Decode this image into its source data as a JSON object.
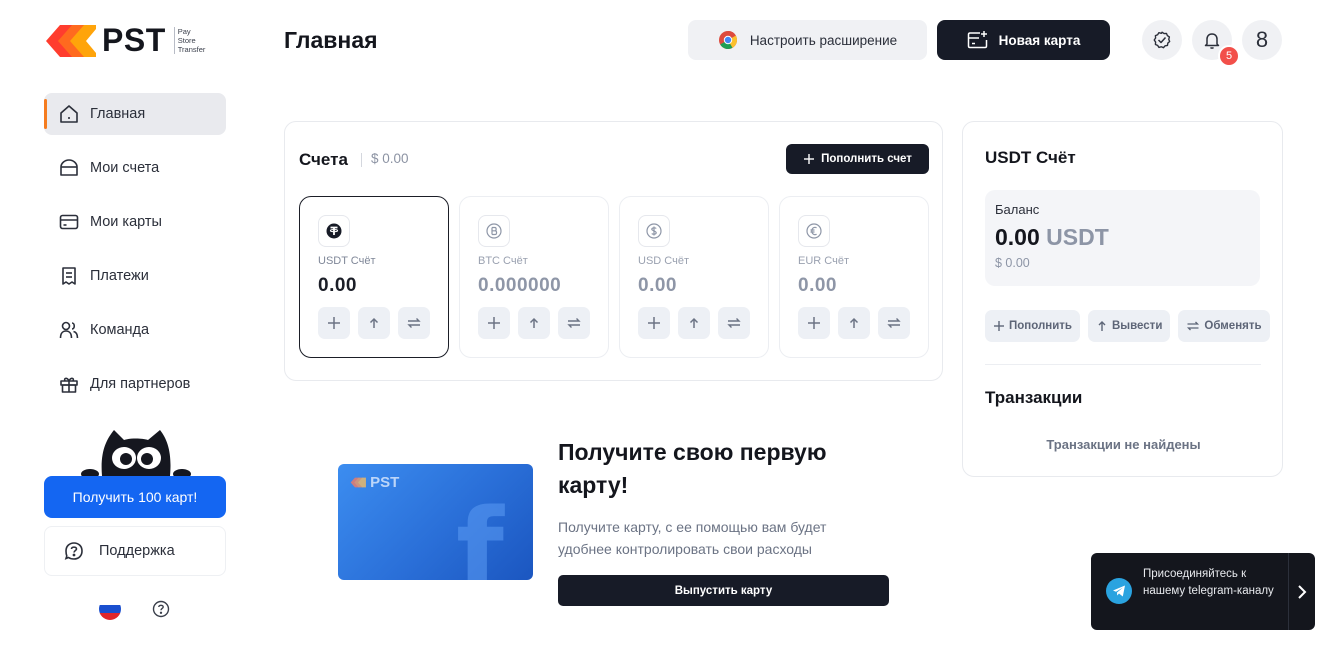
{
  "brand": {
    "name": "PST",
    "sub_line1": "Pay",
    "sub_line2": "Store",
    "sub_line3": "Transfer"
  },
  "sidebar": {
    "items": [
      {
        "label": "Главная",
        "icon": "home-icon",
        "active": true
      },
      {
        "label": "Мои счета",
        "icon": "wallet-icon",
        "active": false
      },
      {
        "label": "Мои карты",
        "icon": "card-icon",
        "active": false
      },
      {
        "label": "Платежи",
        "icon": "receipt-icon",
        "active": false
      },
      {
        "label": "Команда",
        "icon": "team-icon",
        "active": false
      },
      {
        "label": "Для партнеров",
        "icon": "gift-icon",
        "active": false
      }
    ],
    "promo_button": "Получить 100 карт!",
    "support_label": "Поддержка"
  },
  "header": {
    "title": "Главная",
    "extension_button": "Настроить расширение",
    "new_card_button": "Новая карта",
    "notification_count": "5",
    "avatar_initial": "8"
  },
  "accounts": {
    "title": "Счета",
    "total": "$ 0.00",
    "topup_button": "Пополнить счет",
    "cards": [
      {
        "name": "USDT Счёт",
        "amount": "0.00",
        "icon": "tether-icon",
        "active": true
      },
      {
        "name": "BTC Счёт",
        "amount": "0.000000",
        "icon": "bitcoin-icon",
        "active": false
      },
      {
        "name": "USD Счёт",
        "amount": "0.00",
        "icon": "dollar-icon",
        "active": false
      },
      {
        "name": "EUR Счёт",
        "amount": "0.00",
        "icon": "euro-icon",
        "active": false
      }
    ]
  },
  "promo": {
    "card_logo": "PST",
    "title": "Получите свою первую карту!",
    "text": "Получите карту, с ее помощью вам будет удобнее контролировать свои расходы",
    "button": "Выпустить карту"
  },
  "usdt_panel": {
    "title": "USDT Счёт",
    "balance_label": "Баланс",
    "balance_amount": "0.00",
    "balance_currency": "USDT",
    "balance_usd": "$ 0.00",
    "actions": [
      "Пополнить",
      "Вывести",
      "Обменять"
    ],
    "transactions_title": "Транзакции",
    "transactions_empty": "Транзакции не найдены"
  },
  "telegram_toast": {
    "text": "Присоединяйтесь к нашему telegram-каналу"
  },
  "colors": {
    "accent_orange": "#f57c1f",
    "primary_blue": "#1466f2",
    "dark": "#171b27",
    "badge_red": "#f24f4a",
    "telegram": "#2aa3e0"
  }
}
